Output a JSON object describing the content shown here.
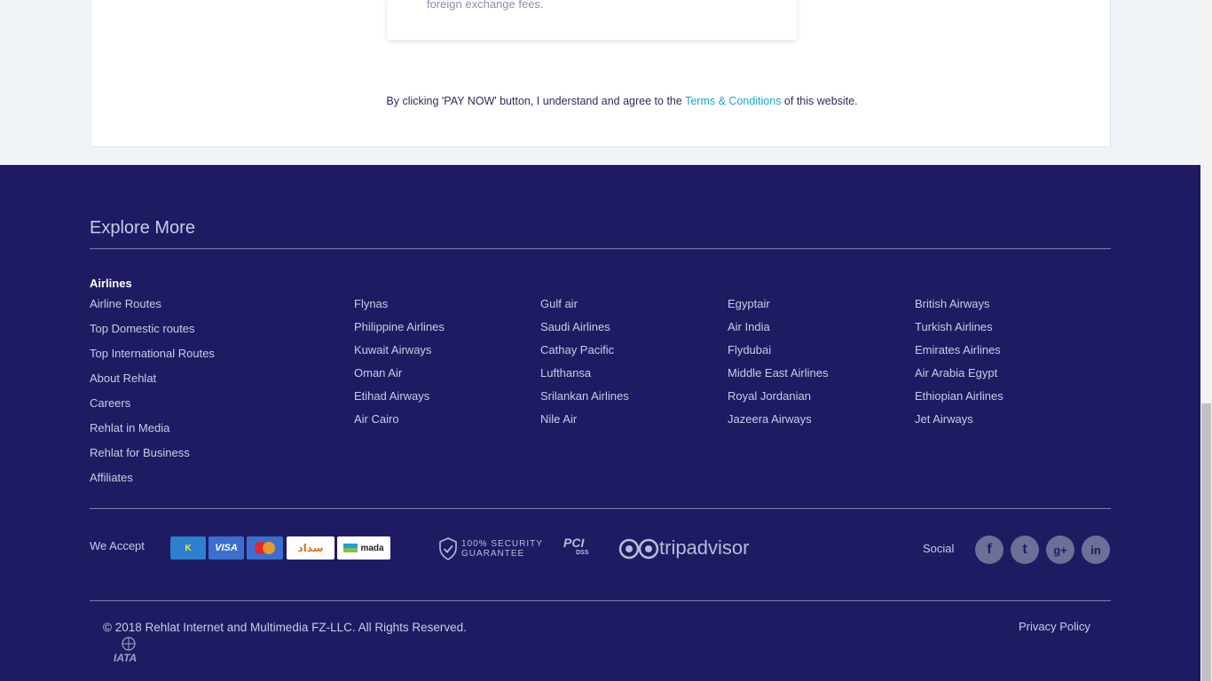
{
  "card": {
    "text": "foreign exchange fees."
  },
  "agreement": {
    "before": "By clicking 'PAY NOW' button, I understand and agree to the ",
    "link": "Terms & Conditions",
    "after": " of this website."
  },
  "footer": {
    "title": "Explore More",
    "airlines_heading": "Airlines",
    "links": [
      "Airline Routes",
      "Top Domestic routes",
      "Top International Routes",
      "About Rehlat",
      "Careers",
      "Rehlat in Media",
      "Rehlat for Business",
      "Affiliates"
    ],
    "airline_cols": [
      [
        "Flynas",
        "Philippine Airlines",
        "Kuwait Airways",
        "Oman Air",
        "Etihad Airways",
        "Air Cairo"
      ],
      [
        "Gulf air",
        "Saudi Airlines",
        "Cathay Pacific",
        "Lufthansa",
        "Srilankan Airlines",
        "Nile Air"
      ],
      [
        "Egyptair",
        "Air India",
        "Flydubai",
        "Middle East Airlines",
        "Royal Jordanian",
        "Jazeera Airways"
      ],
      [
        "British Airways",
        "Turkish Airlines",
        "Emirates Airlines",
        "Air Arabia Egypt",
        "Ethiopian Airlines",
        "Jet Airways"
      ]
    ],
    "we_accept": "We Accept",
    "payments": {
      "knet": "K",
      "visa": "VISA",
      "sadad": "سداد",
      "mada": "mada"
    },
    "security_line1": "100% SECURITY",
    "security_line2": "GUARANTEE",
    "pci": "PCI",
    "pci_sub": "DSS",
    "tripadvisor": "tripadvisor",
    "social_label": "Social",
    "social": {
      "facebook": "f",
      "twitter": "t",
      "googleplus": "g+",
      "linkedin": "in"
    },
    "copyright": "© 2018 Rehlat Internet and Multimedia FZ-LLC. All Rights Reserved.",
    "privacy": "Privacy Policy",
    "iata": "IATA"
  },
  "colors": {
    "footer_bg": "#1f1b63",
    "link": "#c9cbe4",
    "accent": "#1aa3c8"
  }
}
